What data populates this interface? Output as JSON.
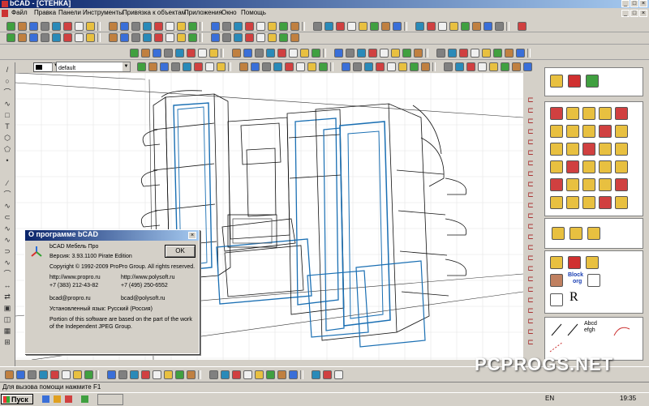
{
  "window": {
    "title": "bCAD - [СТЕНКА]"
  },
  "menu": {
    "items": [
      "Файл",
      "Правка",
      "Панели",
      "Инструменты",
      "Привязка к объектам",
      "Приложения",
      "Окно",
      "Помощь"
    ]
  },
  "properties_bar": {
    "layer_value": "default"
  },
  "about_dialog": {
    "title": "О программе bCAD",
    "ok_label": "OK",
    "product": "bCAD Мебель Про",
    "version": "Версия: 3.93.1100  Pirate Edition",
    "copyright": "Copyright © 1992-2009 ProPro Group. All rights reserved.",
    "site1": "http://www.propro.ru",
    "phone1": "+7 (383) 212-43-82",
    "site2": "http://www.polysoft.ru",
    "phone2": "+7 (495) 250-6552",
    "email1": "bcad@propro.ru",
    "email2": "bcad@polysoft.ru",
    "language": "Установленный язык: Русский (Россия)",
    "notice": "Portion of this software are based on the part of the work of the Independent JPEG Group."
  },
  "right_panel": {
    "block_label": "Block",
    "org_label": "org",
    "abcd_label": "Abcd",
    "efgh_label": "efgh"
  },
  "status_bar": {
    "hint": "Для вызова помощи нажмите F1"
  },
  "taskbar": {
    "start_label": "Пуск",
    "language": "EN",
    "clock": "19:35"
  },
  "watermark": "PCPROGS.NET",
  "colors": {
    "title_gradient_start": "#0a246a",
    "title_gradient_end": "#a6caf0",
    "model_blue": "#1a6fb3",
    "model_black": "#111111"
  }
}
